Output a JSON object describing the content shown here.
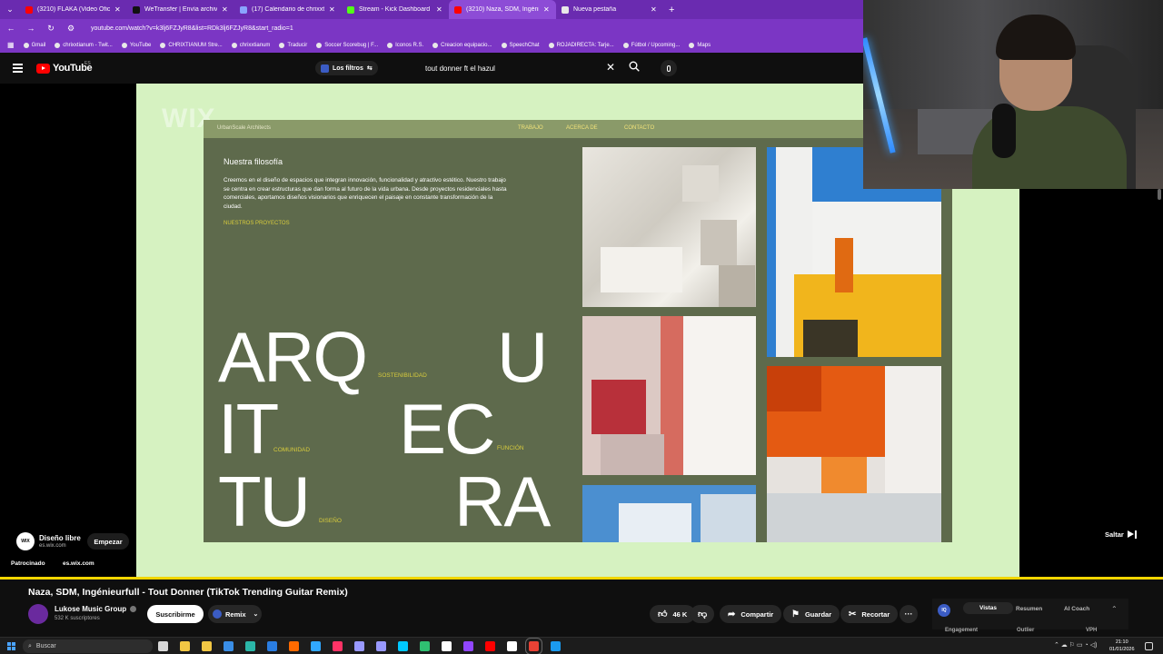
{
  "browser": {
    "tabs": [
      {
        "label": "(3210) FLAKA (Video Oficial) - Y",
        "color": "#ff0000",
        "active": false
      },
      {
        "label": "WeTransfer | Envía archivos gra",
        "color": "#111111",
        "active": false
      },
      {
        "label": "(17) Calendario de chrixxtianu",
        "color": "#8aa4ff",
        "active": false
      },
      {
        "label": "Stream - Kick Dashboard",
        "color": "#53fc18",
        "active": false
      },
      {
        "label": "(3210) Naza, SDM, Ingénieurfu",
        "color": "#ff0000",
        "active": true
      },
      {
        "label": "Nueva pestaña",
        "color": "#e8e8e8",
        "active": false
      }
    ],
    "url": "youtube.com/watch?v=k3lj6FZJyR8&list=RDk3lj6FZJyR8&start_radio=1",
    "bookmarks": [
      "Gmail",
      "chrixxtianum - Twit...",
      "YouTube",
      "CHRIXTIANUM Stre...",
      "chrixxtianum",
      "Traducir",
      "Soccer Scorebug | F...",
      "Iconos R.S.",
      "Creacion equipacio...",
      "SpeechChat",
      "ROJADIRECTA: Tarje...",
      "Fútbol / Upcoming...",
      "Maps"
    ]
  },
  "header": {
    "logo": "YouTube",
    "country": "ES",
    "filters_label": "Los filtros",
    "search_value": "tout donner ft el hazul"
  },
  "ad": {
    "website": {
      "ghost_logo": "WIX",
      "brand": "UrbanScale Architects",
      "nav": [
        "TRABAJO",
        "ACERCA DE",
        "CONTACTO"
      ],
      "section_title": "Nuestra filosofía",
      "section_body": "Creemos en el diseño de espacios que integran innovación, funcionalidad y atractivo estético. Nuestro trabajo se centra en crear estructuras que dan forma al futuro de la vida urbana. Desde proyectos residenciales hasta comerciales, aportamos diseños visionarios que enriquecen el paisaje en constante transformación de la ciudad.",
      "section_link": "NUESTROS PROYECTOS",
      "big_letters": [
        "ARQ",
        "U",
        "IT",
        "EC",
        "TU",
        "RA"
      ],
      "tags": [
        "SOSTENIBILIDAD",
        "COMUNIDAD",
        "FUNCIÓN",
        "DISEÑO"
      ]
    },
    "advertiser_logo": "WIX",
    "advertiser_title": "Diseño libre",
    "advertiser_url": "es.wix.com",
    "cta": "Empezar",
    "sponsored_label": "Patrocinado",
    "sponsored_url": "es.wix.com",
    "skip_label": "Saltar"
  },
  "video": {
    "title": "Naza, SDM, Ingénieurfull - Tout Donner (TikTok Trending Guitar Remix)",
    "channel": "Lukose Music Group",
    "subscribers": "532 K suscriptores",
    "subscribe_label": "Suscribirme",
    "remix_label": "Remix",
    "likes": "46 K",
    "share_label": "Compartir",
    "save_label": "Guardar",
    "clip_label": "Recortar"
  },
  "side_panel": {
    "icon_text": "IQ",
    "tabs": [
      "Vistas",
      "Resumen",
      "AI Coach"
    ],
    "subtabs": [
      "Engagement",
      "Outlier",
      "VPH"
    ]
  },
  "taskbar": {
    "search_placeholder": "Buscar",
    "time": "21:10",
    "date": "01/01/2026",
    "app_colors": [
      "#d8d8d8",
      "#f2c744",
      "#f2c744",
      "#3a8ee6",
      "#2bb6a8",
      "#2a7de1",
      "#ff6a00",
      "#31a8ff",
      "#ff3366",
      "#9999ff",
      "#9999ff",
      "#00c8ff",
      "#2fbf71",
      "#ffffff",
      "#9146ff",
      "#ff0000",
      "#ffffff",
      "#e94235",
      "#1b9aee"
    ]
  }
}
